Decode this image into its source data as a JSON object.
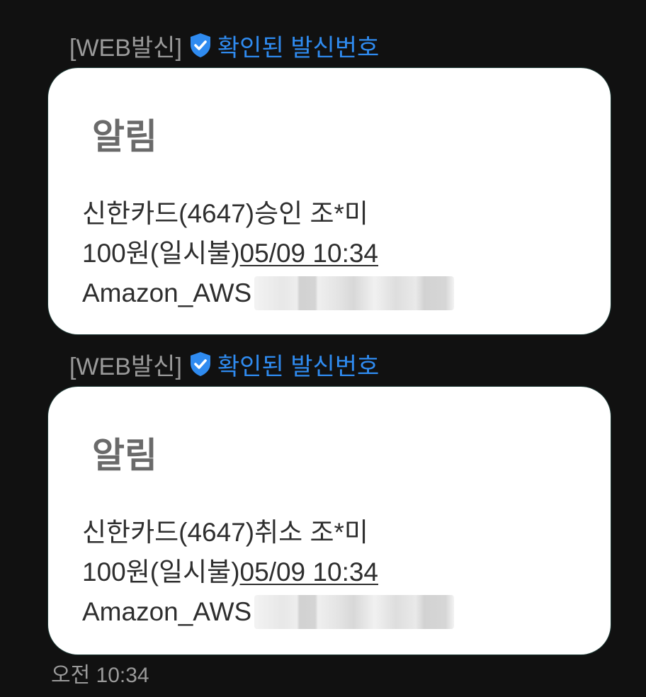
{
  "messages": [
    {
      "sender_tag": "[WEB발신]",
      "verified_label": "확인된 발신번호",
      "title": "알림",
      "line1": "신한카드(4647)승인 조*미",
      "line2_amount": "100원(일시불)",
      "line2_datetime": "05/09 10:34",
      "line3_merchant": "Amazon_AWS"
    },
    {
      "sender_tag": "[WEB발신]",
      "verified_label": "확인된 발신번호",
      "title": "알림",
      "line1": "신한카드(4647)취소 조*미",
      "line2_amount": "100원(일시불)",
      "line2_datetime": "05/09 10:34",
      "line3_merchant": "Amazon_AWS"
    }
  ],
  "timestamp": "오전 10:34",
  "colors": {
    "background": "#111111",
    "bubble": "#ffffff",
    "verified_accent": "#2f8bf0",
    "muted_text": "#9a9a9a"
  },
  "icons": {
    "verified": "shield-check-icon"
  }
}
